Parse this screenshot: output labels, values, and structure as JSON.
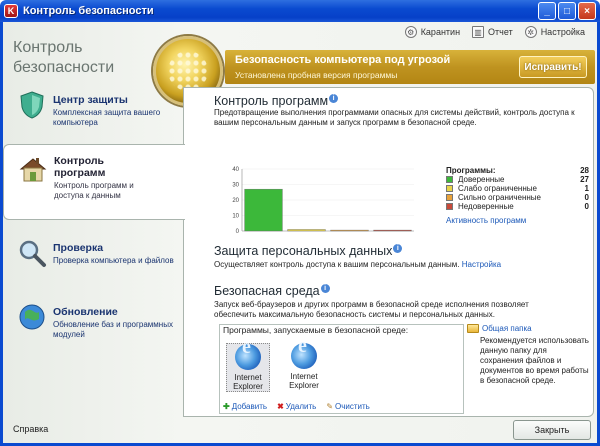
{
  "window": {
    "title": "Контроль безопасности"
  },
  "app_title": "Контроль безопасности",
  "toolbar": [
    {
      "icon": "quarantine-icon",
      "label": "Карантин"
    },
    {
      "icon": "report-icon",
      "label": "Отчет"
    },
    {
      "icon": "settings-icon",
      "label": "Настройка"
    }
  ],
  "banner": {
    "title": "Безопасность компьютера под угрозой",
    "subtitle": "Установлена пробная версия программы",
    "fix_button": "Исправить!"
  },
  "nav": [
    {
      "title": "Центр защиты",
      "desc": "Комплексная защита вашего компьютера",
      "active": false
    },
    {
      "title": "Контроль программ",
      "desc": "Контроль программ и доступа к данным",
      "active": true
    },
    {
      "title": "Проверка",
      "desc": "Проверка компьютера и файлов",
      "active": false
    },
    {
      "title": "Обновление",
      "desc": "Обновление баз и программных модулей",
      "active": false
    }
  ],
  "content": {
    "app_control": {
      "title": "Контроль программ",
      "desc": "Предотвращение выполнения программами опасных для системы действий, контроль доступа к вашим персональным данным и запуск программ в безопасной среде.",
      "activity_link": "Активность программ"
    },
    "personal_data": {
      "title": "Защита персональных данных",
      "desc": "Осуществляет контроль доступа к вашим персональным данным.",
      "settings_link": "Настройка"
    },
    "safe_env": {
      "title": "Безопасная среда",
      "desc": "Запуск веб-браузеров и других программ в безопасной среде исполнения позволяет обеспечить максимальную безопасность системы и персональных данных.",
      "box_header": "Программы, запускаемые в безопасной среде:",
      "programs": [
        {
          "name": "Internet Explorer",
          "selected": true
        },
        {
          "name": "Internet Explorer",
          "selected": false
        }
      ],
      "ops": {
        "add": "Добавить",
        "delete": "Удалить",
        "clear": "Очистить"
      },
      "shared_folder_link": "Общая папка",
      "shared_folder_desc": "Рекомендуется использовать данную папку для сохранения файлов и документов во время работы в безопасной среде."
    }
  },
  "chart_data": {
    "type": "bar",
    "categories": [
      "Доверенные",
      "Слабо ограниченные",
      "Сильно ограниченные",
      "Недоверенные"
    ],
    "values": [
      27,
      1,
      0,
      0
    ],
    "ylim": [
      0,
      40
    ],
    "yticks": [
      0,
      10,
      20,
      30,
      40
    ],
    "colors": [
      "#3cb83a",
      "#e8d44a",
      "#e8a23a",
      "#c84a3a"
    ]
  },
  "legend": {
    "total_label": "Программы:",
    "total_value": "28",
    "rows": [
      {
        "label": "Доверенные",
        "value": "27",
        "color": "#3cb83a"
      },
      {
        "label": "Слабо ограниченные",
        "value": "1",
        "color": "#e8d44a"
      },
      {
        "label": "Сильно ограниченные",
        "value": "0",
        "color": "#e8a23a"
      },
      {
        "label": "Недоверенные",
        "value": "0",
        "color": "#c84a3a"
      }
    ]
  },
  "footer": {
    "help": "Справка",
    "close": "Закрыть"
  }
}
